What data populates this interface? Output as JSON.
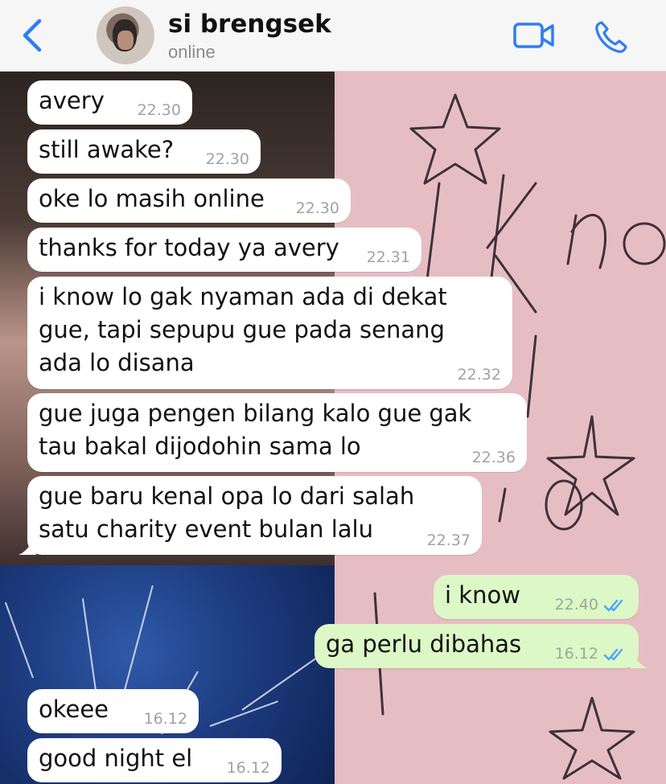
{
  "header": {
    "contact_name": "si brengsek",
    "status": "online",
    "icons": {
      "back": "chevron-left-icon",
      "video": "video-camera-icon",
      "phone": "phone-icon"
    },
    "accent_color": "#2f7cf6"
  },
  "messages": [
    {
      "text": "avery",
      "time": "22.30",
      "direction": "in"
    },
    {
      "text": "still awake?",
      "time": "22.30",
      "direction": "in"
    },
    {
      "text": "oke lo masih online",
      "time": "22.30",
      "direction": "in"
    },
    {
      "text": "thanks for today ya avery",
      "time": "22.31",
      "direction": "in"
    },
    {
      "text": "i know lo gak nyaman ada di dekat gue, tapi sepupu gue pada senang ada lo disana",
      "time": "22.32",
      "direction": "in"
    },
    {
      "text": "gue juga pengen bilang kalo gue gak tau bakal dijodohin sama lo",
      "time": "22.36",
      "direction": "in"
    },
    {
      "text": "gue baru kenal opa lo dari salah satu charity event bulan lalu",
      "time": "22.37",
      "direction": "in"
    },
    {
      "text": "i know",
      "time": "22.40",
      "direction": "out",
      "read": true
    },
    {
      "text": "ga perlu dibahas",
      "time": "16.12",
      "direction": "out",
      "read": true
    },
    {
      "text": "okeee",
      "time": "16.12",
      "direction": "in"
    },
    {
      "text": "good night el",
      "time": "16.12",
      "direction": "in"
    }
  ],
  "colors": {
    "incoming_bubble": "#ffffff",
    "outgoing_bubble": "#dcf8c6",
    "read_ticks": "#4fa3f7"
  }
}
